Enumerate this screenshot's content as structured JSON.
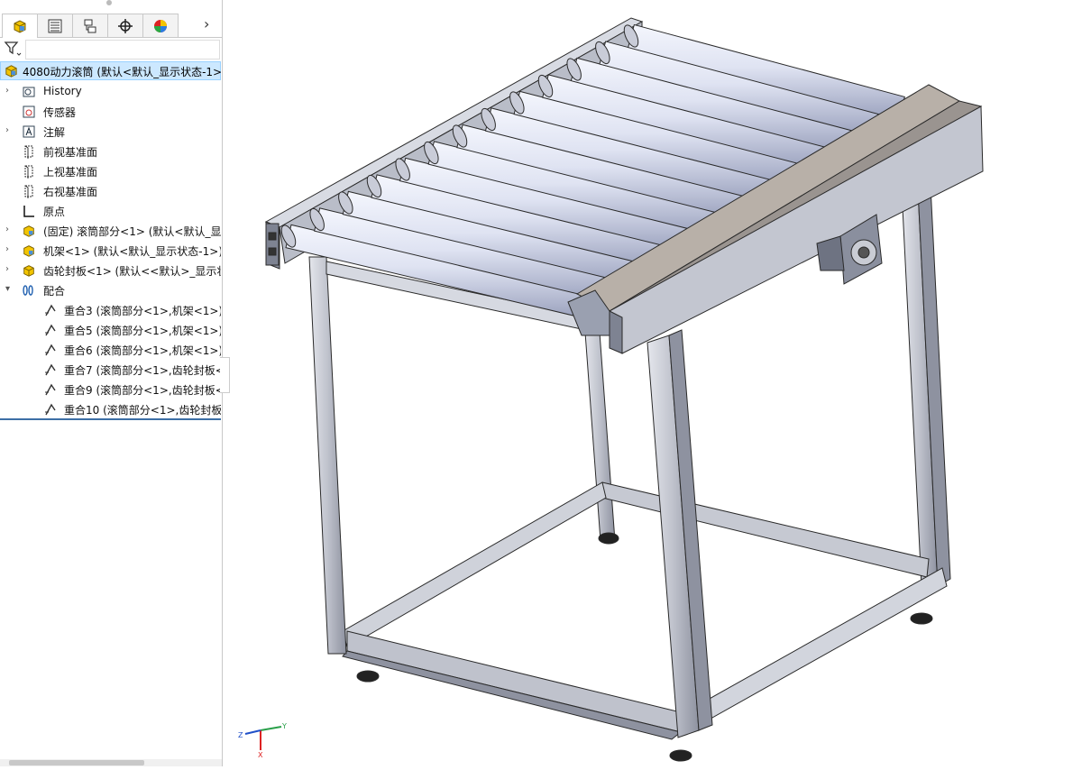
{
  "feature_tree": {
    "tabs": [
      {
        "name": "featuremanager",
        "icon": "assembly-icon"
      },
      {
        "name": "propertymanager",
        "icon": "property-list-icon"
      },
      {
        "name": "configurationmanager",
        "icon": "configuration-icon"
      },
      {
        "name": "dimxpert",
        "icon": "crosshair-icon"
      },
      {
        "name": "display-manager",
        "icon": "appearance-ball-icon"
      }
    ],
    "more_label": "›",
    "root": {
      "label": "4080动力滚筒 (默认<默认_显示状态-1>",
      "icon": "assembly-icon"
    },
    "items": [
      {
        "label": "History",
        "icon": "history-icon",
        "expandable": true
      },
      {
        "label": "传感器",
        "icon": "sensor-icon",
        "expandable": false
      },
      {
        "label": "注解",
        "icon": "annotation-icon",
        "expandable": true
      },
      {
        "label": "前视基准面",
        "icon": "plane-icon",
        "expandable": false
      },
      {
        "label": "上视基准面",
        "icon": "plane-icon",
        "expandable": false
      },
      {
        "label": "右视基准面",
        "icon": "plane-icon",
        "expandable": false
      },
      {
        "label": "原点",
        "icon": "origin-icon",
        "expandable": false
      },
      {
        "label": "(固定) 滚筒部分<1> (默认<默认_显示",
        "icon": "subassembly-icon",
        "expandable": true
      },
      {
        "label": "机架<1> (默认<默认_显示状态-1>)",
        "icon": "subassembly-icon",
        "expandable": true
      },
      {
        "label": "齿轮封板<1> (默认<<默认>_显示状",
        "icon": "part-icon",
        "expandable": true
      },
      {
        "label": "配合",
        "icon": "mates-icon",
        "expandable": true,
        "expanded": true
      }
    ],
    "mates": [
      {
        "label": "重合3 (滚筒部分<1>,机架<1>)"
      },
      {
        "label": "重合5 (滚筒部分<1>,机架<1>)"
      },
      {
        "label": "重合6 (滚筒部分<1>,机架<1>)"
      },
      {
        "label": "重合7 (滚筒部分<1>,齿轮封板<"
      },
      {
        "label": "重合9 (滚筒部分<1>,齿轮封板<"
      },
      {
        "label": "重合10 (滚筒部分<1>,齿轮封板<"
      }
    ]
  },
  "triad": {
    "x": "X",
    "y": "Y",
    "z": "Z"
  },
  "colors": {
    "selection": "#cce8ff",
    "frame": "#c9ccd4",
    "roller": "#dfe3f2",
    "plate": "#b8b0a8",
    "edge": "#2a2a2a"
  }
}
